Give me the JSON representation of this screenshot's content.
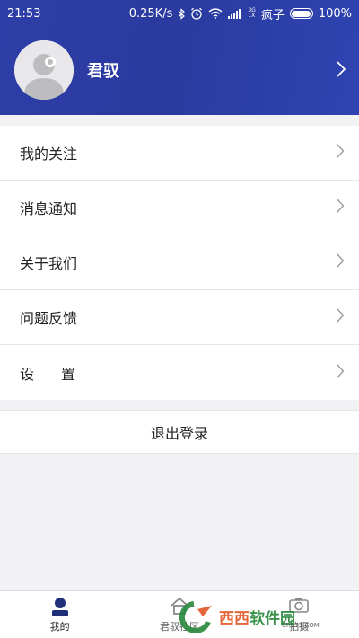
{
  "status_bar": {
    "time": "21:53",
    "speed": "0.25K/s",
    "net_top": "3G",
    "net_bottom": "1X",
    "carrier": "疯子",
    "battery": "100%"
  },
  "profile": {
    "username": "君驭"
  },
  "menu": {
    "items": [
      {
        "label": "我的关注"
      },
      {
        "label": "消息通知"
      },
      {
        "label": "关于我们"
      },
      {
        "label": "问题反馈"
      },
      {
        "label": "设置"
      }
    ]
  },
  "logout_label": "退出登录",
  "tabbar": {
    "tabs": [
      {
        "label": "我的",
        "active": true
      },
      {
        "label": "君驭社区",
        "active": false
      },
      {
        "label": "拍摄",
        "active": false
      }
    ]
  },
  "watermark": {
    "part1": "西西",
    "part2": "软件园",
    "sub": "CR173.COM"
  },
  "colors": {
    "header": "#2e3ea8",
    "accent": "#1f2f7a",
    "background": "#f2f2f4"
  }
}
